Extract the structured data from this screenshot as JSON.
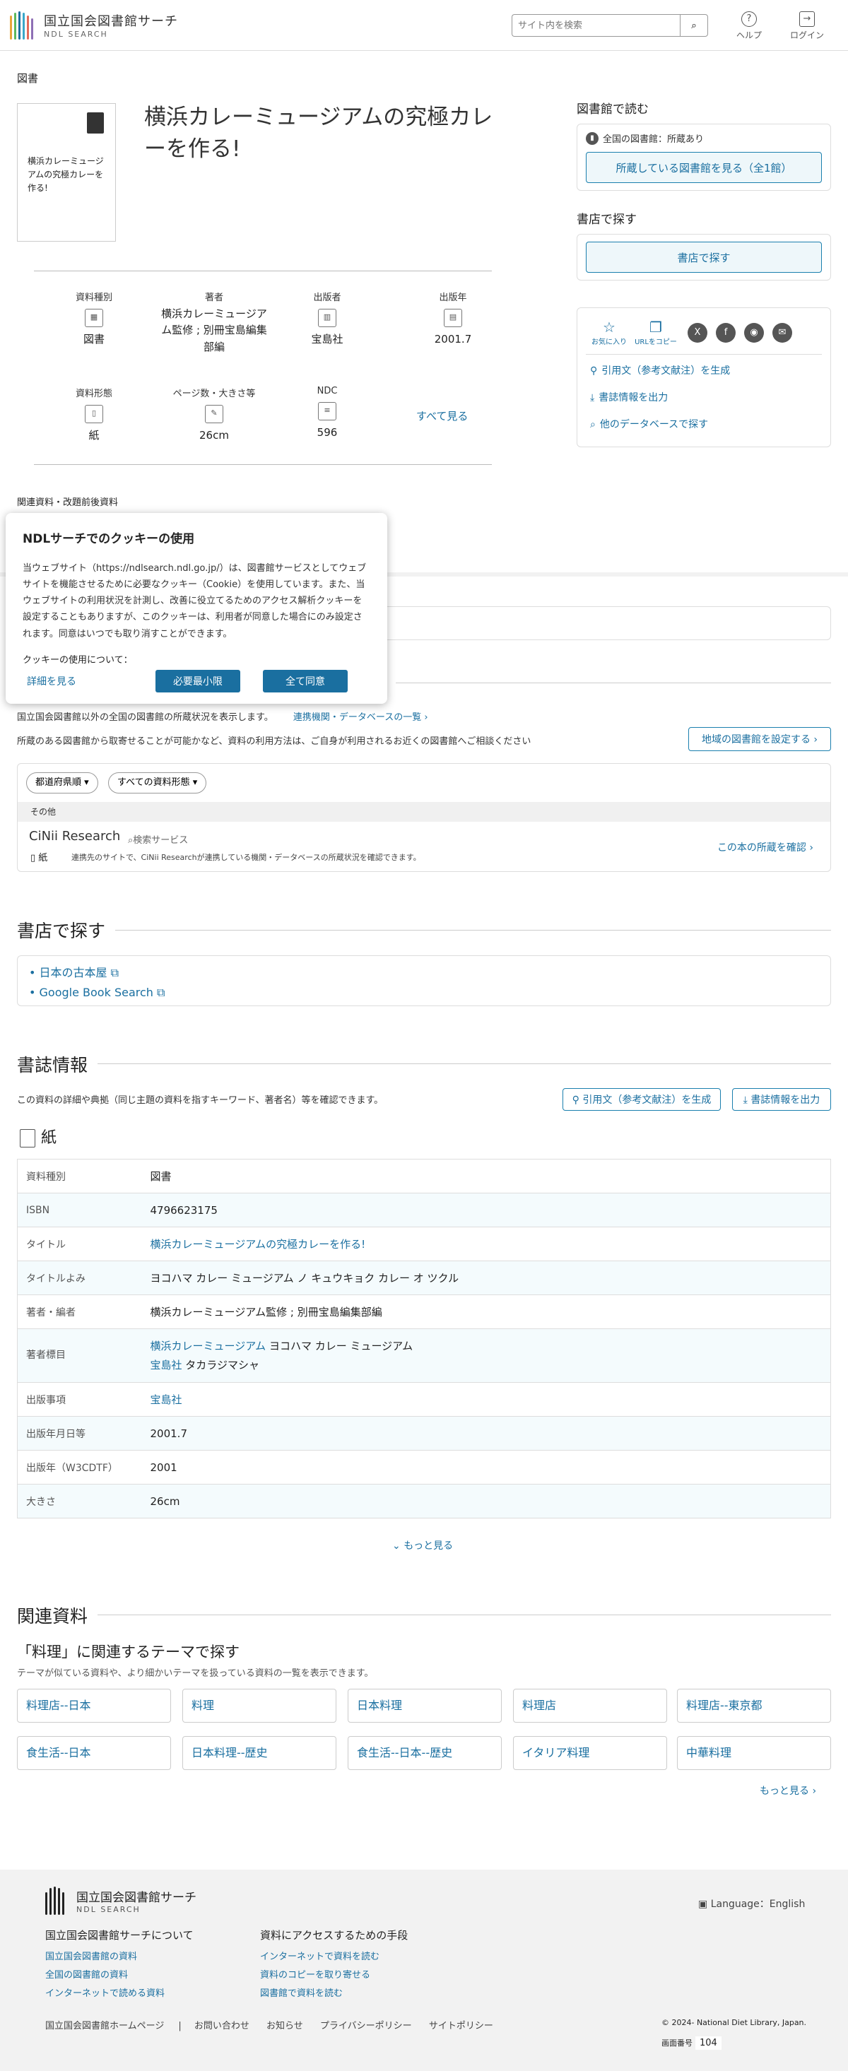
{
  "header": {
    "logo_jp": "国立国会図書館サーチ",
    "logo_en": "NDL SEARCH",
    "search_placeholder": "サイト内を検索",
    "help": "ヘルプ",
    "login": "ログイン"
  },
  "breadcrumb": "図書",
  "book": {
    "thumb_title": "横浜カレーミュージアムの究極カレーを作る!",
    "title": "横浜カレーミュージアムの究極カレーを作る!"
  },
  "meta": [
    {
      "label": "資料種別",
      "value": "図書",
      "icon": "book-type-icon"
    },
    {
      "label": "著者",
      "value": "横浜カレーミュージアム監修 ; 別冊宝島編集部編",
      "icon": "author-icon"
    },
    {
      "label": "出版者",
      "value": "宝島社",
      "icon": "publisher-icon"
    },
    {
      "label": "出版年",
      "value": "2001.7",
      "icon": "calendar-icon"
    },
    {
      "label": "資料形態",
      "value": "紙",
      "icon": "paper-icon"
    },
    {
      "label": "ページ数・大きさ等",
      "value": "26cm",
      "icon": "ruler-icon"
    },
    {
      "label": "NDC",
      "value": "596",
      "icon": "ndc-icon"
    }
  ],
  "see_all": "すべて見る",
  "related_head": "関連資料・改題前後資料",
  "sidebar": {
    "read_heading": "図書館で読む",
    "holding_note": "全国の図書館：所蔵あり",
    "holding_button": "所蔵している図書館を見る（全1館）",
    "shop_heading": "書店で探す",
    "shop_button": "書店で探す",
    "favorite": "お気に入り",
    "copy_url": "URLをコピー",
    "cite": "引用文（参考文献注）を生成",
    "export": "書誌情報を出力",
    "other_db": "他のデータベースで探す"
  },
  "cookie": {
    "title": "NDLサーチでのクッキーの使用",
    "body": "当ウェブサイト（https://ndlsearch.ndl.go.jp/）は、図書館サービスとしてウェブサイトを機能させるために必要なクッキー（Cookie）を使用しています。また、当ウェブサイトの利用状況を計測し、改善に役立てるためのアクセス解析クッキーを設定することもありますが、このクッキーは、利用者が同意した場合にのみ設定されます。同意はいつでも取り消すことができます。",
    "question": "クッキーの使用について：",
    "detail": "詳細を見る",
    "minimum": "必要最小限",
    "accept_all": "全て同意"
  },
  "library": {
    "note": "国立国会図書館以外の全国の図書館の所蔵状況を表示します。",
    "partner_link": "連携機関・データベースの一覧",
    "note2": "所蔵のある図書館から取寄せることが可能かなど、資料の利用方法は、ご自身が利用されるお近くの図書館へご相談ください",
    "region_button": "地域の図書館を設定する",
    "filter_pref": "都道府県順",
    "filter_type": "すべての資料形態",
    "category": "その他",
    "holder": "CiNii Research",
    "service": "検索サービス",
    "form": "紙",
    "desc": "連携先のサイトで、CiNii Researchが連携している機関・データベースの所蔵状況を確認できます。",
    "check_link": "この本の所蔵を確認"
  },
  "shop": {
    "heading": "書店で探す",
    "links": [
      "日本の古本屋",
      "Google Book Search"
    ]
  },
  "biblio": {
    "heading": "書誌情報",
    "note": "この資料の詳細や典拠（同じ主題の資料を指すキーワード、著者名）等を確認できます。",
    "cite_button": "引用文（参考文献注）を生成",
    "export_button": "書誌情報を出力",
    "form": "紙",
    "rows": [
      {
        "k": "資料種別",
        "v": "図書"
      },
      {
        "k": "ISBN",
        "v": "4796623175"
      },
      {
        "k": "タイトル",
        "v": "横浜カレーミュージアムの究極カレーを作る!"
      },
      {
        "k": "タイトルよみ",
        "v": "ヨコハマ カレー ミュージアム ノ キュウキョク カレー オ ツクル"
      },
      {
        "k": "著者・編者",
        "v": "横浜カレーミュージアム監修 ; 別冊宝島編集部編"
      },
      {
        "k": "著者標目",
        "v1_link": "横浜カレーミュージアム",
        "v1_read": "ヨコハマ カレー ミュージアム",
        "v2_link": "宝島社",
        "v2_read": "タカラジマシャ"
      },
      {
        "k": "出版事項",
        "v": "宝島社"
      },
      {
        "k": "出版年月日等",
        "v": "2001.7"
      },
      {
        "k": "出版年（W3CDTF）",
        "v": "2001"
      },
      {
        "k": "大きさ",
        "v": "26cm"
      }
    ],
    "more": "もっと見る"
  },
  "related": {
    "heading": "関連資料",
    "theme_heading": "「料理」に関連するテーマで探す",
    "theme_note": "テーマが似ている資料や、より細かいテーマを扱っている資料の一覧を表示できます。",
    "tags": [
      "料理店--日本",
      "料理",
      "日本料理",
      "料理店",
      "料理店--東京都",
      "食生活--日本",
      "日本料理--歴史",
      "食生活--日本--歴史",
      "イタリア料理",
      "中華料理"
    ],
    "more": "もっと見る"
  },
  "footer": {
    "logo_jp": "国立国会図書館サーチ",
    "logo_en": "NDL SEARCH",
    "language": "Language：English",
    "col1_h": "国立国会図書館サーチについて",
    "col1": [
      "国立国会図書館の資料",
      "全国の図書館の資料",
      "インターネットで読める資料"
    ],
    "col2_h": "資料にアクセスするための手段",
    "col2": [
      "インターネットで資料を読む",
      "資料のコピーを取り寄せる",
      "図書館で資料を読む"
    ],
    "bottom": [
      "国立国会図書館ホームページ",
      "お問い合わせ",
      "お知らせ",
      "プライバシーポリシー",
      "サイトポリシー"
    ],
    "copyright": "© 2024- National Diet Library, Japan.",
    "page_label": "画面番号",
    "page_no": "104"
  },
  "colors": {
    "accent": "#1a6fa0",
    "logo": [
      "#e8a53a",
      "#5cb85c",
      "#1a6fa0",
      "#3aa7c9",
      "#e36a5a",
      "#8e6fb5"
    ]
  }
}
